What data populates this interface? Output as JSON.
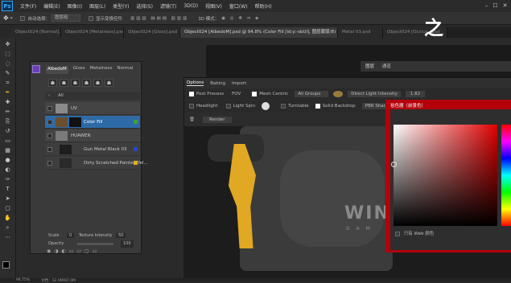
{
  "app": {
    "logo": "Ps"
  },
  "menu": [
    "文件(F)",
    "编辑(E)",
    "图像(I)",
    "图层(L)",
    "类型(Y)",
    "选择(S)",
    "滤镜(T)",
    "3D(D)",
    "视图(V)",
    "窗口(W)",
    "帮助(H)"
  ],
  "window_controls": {
    "minimize": "–",
    "maximize": "☐",
    "close": "✕"
  },
  "options_bar": {
    "auto_select": "自动选择：",
    "layer_group": "图层组",
    "transform": "显示变换控件",
    "mode": "3D 模式："
  },
  "doc_tabs": [
    {
      "label": "Object024 [Normal].psd",
      "active": false
    },
    {
      "label": "Object024 [Metalness].psd",
      "active": false
    },
    {
      "label": "Object024 [Gloss].psd",
      "active": false
    },
    {
      "label": "Object024 [AlbedoM].psd @ 94.8% (Color Fill [id:y:-sbUl], 图层蒙版/8) *",
      "active": true
    },
    {
      "label": "Metal 03.psd",
      "active": false
    },
    {
      "label": "Object024 [Occlus...psd",
      "active": false
    }
  ],
  "overlay_mark": "之",
  "layers_panel": {
    "tabs": [
      "AlbedoM",
      "Gloss",
      "Metalness",
      "Normal"
    ],
    "icons": [
      "☗",
      "☗",
      "☗",
      "☗",
      "☗",
      "☗"
    ],
    "breadcrumb_all": "All",
    "layers": [
      {
        "name": "UV",
        "thumb_color": "#8a8a8a",
        "badge": ""
      },
      {
        "name": "Color Fill",
        "thumb_color": "#6b4e2d",
        "badge": "#3ca03c"
      },
      {
        "name": "HUAWEN",
        "thumb_color": "#7a7a7a",
        "badge": ""
      },
      {
        "name": "Gun Metal Black 03",
        "thumb_color": "#1e1e1e",
        "badge": "#2b46c8"
      },
      {
        "name": "Dirty Scratched Painted Yel...",
        "thumb_color": "#2a2a2a",
        "badge": "#e0b21a"
      }
    ],
    "scale_label": "Scale",
    "scale_value": "0",
    "texture_label": "Texture Intensity",
    "texture_value": "50",
    "opacity_label": "Opacity",
    "opacity_value": "100"
  },
  "knald": {
    "header_tabs": [
      "图层",
      "通道"
    ],
    "tabs": [
      "Options",
      "Baking",
      "Import"
    ],
    "row1": {
      "post_process": "Post Process",
      "fov": "FOV",
      "mesh_centric": "Mesh Centric",
      "all_groups": "All Groups",
      "direct_light": "Direct Light Intensity",
      "direct_light_value": "1.82"
    },
    "row2": {
      "headlight": "Headlight",
      "light_spin": "Light Spin",
      "turntable": "Turntable",
      "solid_backdrop": "Solid Backdrop",
      "pbr": "PBR Shad"
    },
    "row3": {
      "render": "Render"
    }
  },
  "model_text": {
    "big": "WIN",
    "small": "G A M"
  },
  "color_picker": {
    "title": "拾色器（前景色）",
    "web_only": "只有 Web 颜色",
    "accent": "#b3000b"
  },
  "statusbar": {
    "zoom": "94.75%",
    "doc": "文档：12.0M/87.0M"
  },
  "colors": {
    "bg": "#282828",
    "panel": "#3a3a3a",
    "highlight": "#2e6aa7",
    "accent_yellow": "#e0a823"
  }
}
